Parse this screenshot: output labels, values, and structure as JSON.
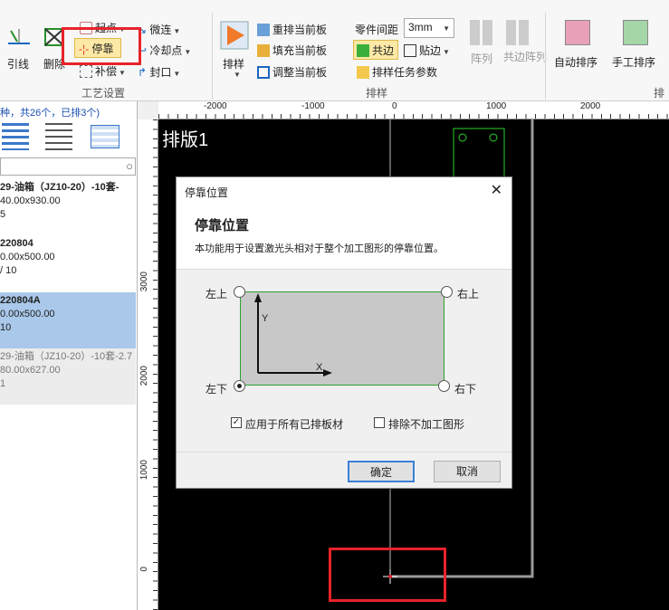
{
  "ribbon": {
    "lead_label": "引线",
    "cut_label": "删除",
    "start_point": "起点",
    "dock": "停靠",
    "compensate": "补偿",
    "micro_join": "微连",
    "cool_point": "冷却点",
    "seal": "封口",
    "process_group": "工艺设置",
    "nest": "排样",
    "reorder_current": "重排当前板",
    "fill_current": "填充当前板",
    "adjust_current": "调整当前板",
    "part_spacing_label": "零件间距",
    "part_spacing_value": "3mm",
    "common_edge": "共边",
    "snap_edge": "贴边",
    "nest_params": "排样任务参数",
    "array": "阵列",
    "common_array": "共边阵列",
    "nest_group": "排样",
    "auto_sort": "自动排序",
    "manual_sort": "手工排序",
    "sort_group": "排序"
  },
  "left_panel": {
    "summary": "种，共26个，已排3个)",
    "items": [
      {
        "name": "29-油箱（JZ10-20）-10套-",
        "size": "40.00x930.00",
        "count": "5"
      },
      {
        "name": "220804",
        "size": "0.00x500.00",
        "count": "/ 10"
      },
      {
        "name": "220804A",
        "size": "0.00x500.00",
        "count": "10"
      },
      {
        "name": "29-油箱（JZ10-20）-10套-2.7",
        "size": "80.00x627.00",
        "count": "1"
      }
    ]
  },
  "canvas": {
    "title": "排版1",
    "h_ticks": [
      "-2000",
      "-1000",
      "0",
      "1000",
      "2000"
    ],
    "v_ticks": [
      "3000",
      "2000",
      "1000",
      "0"
    ]
  },
  "dialog": {
    "title": "停靠位置",
    "heading": "停靠位置",
    "description": "本功能用于设置激光头相对于整个加工图形的停靠位置。",
    "top_left": "左上",
    "top_right": "右上",
    "bottom_left": "左下",
    "bottom_right": "右下",
    "axis_y": "Y",
    "axis_x": "X",
    "apply_all": "应用于所有已排板材",
    "exclude_unprocessed": "排除不加工图形",
    "ok": "确定",
    "cancel": "取消"
  },
  "colors": {
    "highlight": "#e8232a",
    "selected_row": "#a9c8ea",
    "plate_line": "#9a9a9a",
    "part_outline": "#2bd12b"
  }
}
